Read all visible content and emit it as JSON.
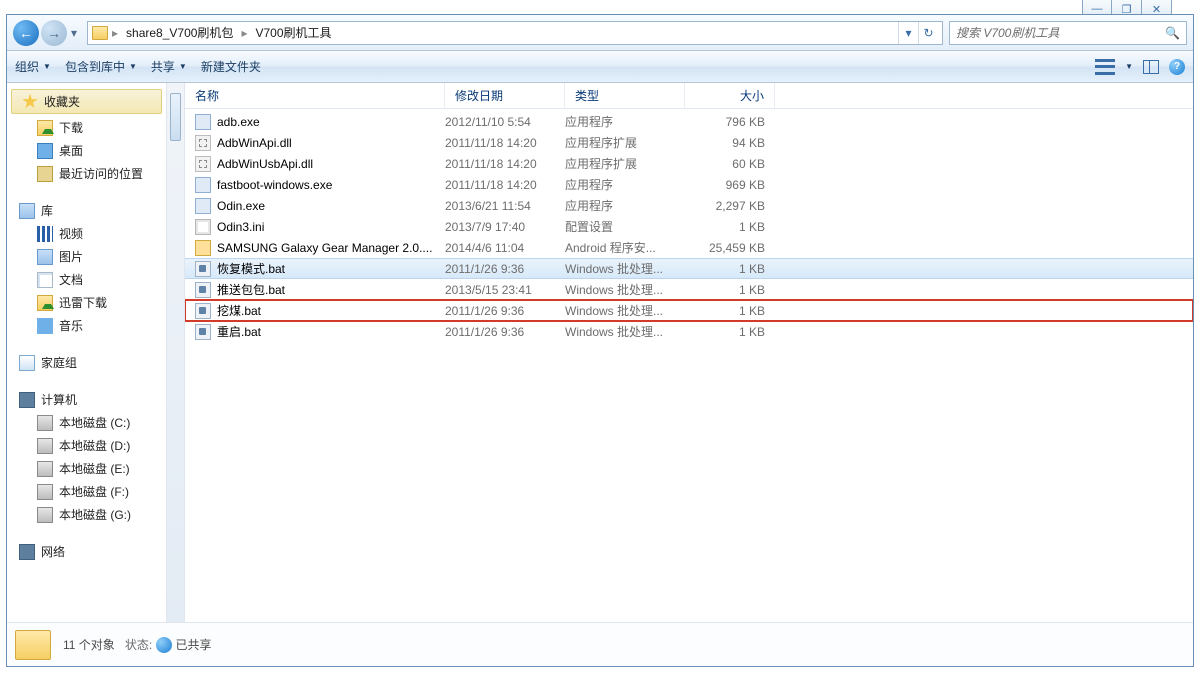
{
  "caption": {
    "min": "—",
    "restore": "❐",
    "close": "✕"
  },
  "nav": {
    "back": "←",
    "fwd": "→",
    "crumbs": [
      "share8_V700刷机包",
      "V700刷机工具"
    ],
    "sep": "▸",
    "refresh": "↻",
    "dd": "▾",
    "search_placeholder": "搜索 V700刷机工具"
  },
  "toolbar": {
    "organize": "组织",
    "include": "包含到库中",
    "share": "共享",
    "newfolder": "新建文件夹",
    "tri": "▼"
  },
  "columns": {
    "name": "名称",
    "date": "修改日期",
    "type": "类型",
    "size": "大小"
  },
  "files": [
    {
      "ic": "ic-exe",
      "name": "adb.exe",
      "date": "2012/11/10 5:54",
      "type": "应用程序",
      "size": "796 KB",
      "sel": false,
      "hl": false
    },
    {
      "ic": "ic-dll",
      "name": "AdbWinApi.dll",
      "date": "2011/11/18 14:20",
      "type": "应用程序扩展",
      "size": "94 KB",
      "sel": false,
      "hl": false
    },
    {
      "ic": "ic-dll",
      "name": "AdbWinUsbApi.dll",
      "date": "2011/11/18 14:20",
      "type": "应用程序扩展",
      "size": "60 KB",
      "sel": false,
      "hl": false
    },
    {
      "ic": "ic-exe",
      "name": "fastboot-windows.exe",
      "date": "2011/11/18 14:20",
      "type": "应用程序",
      "size": "969 KB",
      "sel": false,
      "hl": false
    },
    {
      "ic": "ic-exe",
      "name": "Odin.exe",
      "date": "2013/6/21 11:54",
      "type": "应用程序",
      "size": "2,297 KB",
      "sel": false,
      "hl": false
    },
    {
      "ic": "ic-ini",
      "name": "Odin3.ini",
      "date": "2013/7/9 17:40",
      "type": "配置设置",
      "size": "1 KB",
      "sel": false,
      "hl": false
    },
    {
      "ic": "ic-apk",
      "name": "SAMSUNG Galaxy Gear Manager 2.0....",
      "date": "2014/4/6 11:04",
      "type": "Android 程序安...",
      "size": "25,459 KB",
      "sel": false,
      "hl": false
    },
    {
      "ic": "ic-bat",
      "name": "恢复模式.bat",
      "date": "2011/1/26 9:36",
      "type": "Windows 批处理...",
      "size": "1 KB",
      "sel": true,
      "hl": false
    },
    {
      "ic": "ic-bat",
      "name": "推送包包.bat",
      "date": "2013/5/15 23:41",
      "type": "Windows 批处理...",
      "size": "1 KB",
      "sel": false,
      "hl": false
    },
    {
      "ic": "ic-bat",
      "name": "挖煤.bat",
      "date": "2011/1/26 9:36",
      "type": "Windows 批处理...",
      "size": "1 KB",
      "sel": false,
      "hl": true
    },
    {
      "ic": "ic-bat",
      "name": "重启.bat",
      "date": "2011/1/26 9:36",
      "type": "Windows 批处理...",
      "size": "1 KB",
      "sel": false,
      "hl": false
    }
  ],
  "tree": [
    {
      "kind": "grouph fav",
      "ic": "ic-star",
      "label": "收藏夹"
    },
    {
      "kind": "item",
      "ic": "ic-dl",
      "label": "下载"
    },
    {
      "kind": "item",
      "ic": "ic-desktop",
      "label": "桌面"
    },
    {
      "kind": "item",
      "ic": "ic-recent",
      "label": "最近访问的位置"
    },
    {
      "kind": "spacer"
    },
    {
      "kind": "grouph",
      "ic": "ic-lib",
      "label": "库"
    },
    {
      "kind": "item",
      "ic": "ic-strip",
      "label": "视频"
    },
    {
      "kind": "item",
      "ic": "ic-lib",
      "label": "图片"
    },
    {
      "kind": "item",
      "ic": "ic-doc",
      "label": "文档"
    },
    {
      "kind": "item",
      "ic": "ic-dl",
      "label": "迅雷下载"
    },
    {
      "kind": "item",
      "ic": "ic-music",
      "label": "音乐"
    },
    {
      "kind": "spacer"
    },
    {
      "kind": "grouph",
      "ic": "ic-home",
      "label": "家庭组"
    },
    {
      "kind": "spacer"
    },
    {
      "kind": "grouph",
      "ic": "ic-pc",
      "label": "计算机"
    },
    {
      "kind": "item",
      "ic": "ic-drive",
      "label": "本地磁盘 (C:)"
    },
    {
      "kind": "item",
      "ic": "ic-drive",
      "label": "本地磁盘 (D:)"
    },
    {
      "kind": "item",
      "ic": "ic-drive",
      "label": "本地磁盘 (E:)"
    },
    {
      "kind": "item",
      "ic": "ic-drive",
      "label": "本地磁盘 (F:)"
    },
    {
      "kind": "item",
      "ic": "ic-drive",
      "label": "本地磁盘 (G:)"
    },
    {
      "kind": "spacer"
    },
    {
      "kind": "grouph",
      "ic": "ic-net",
      "label": "网络"
    }
  ],
  "status": {
    "count": "11 个对象",
    "state_label": "状态:",
    "shared": "已共享"
  }
}
